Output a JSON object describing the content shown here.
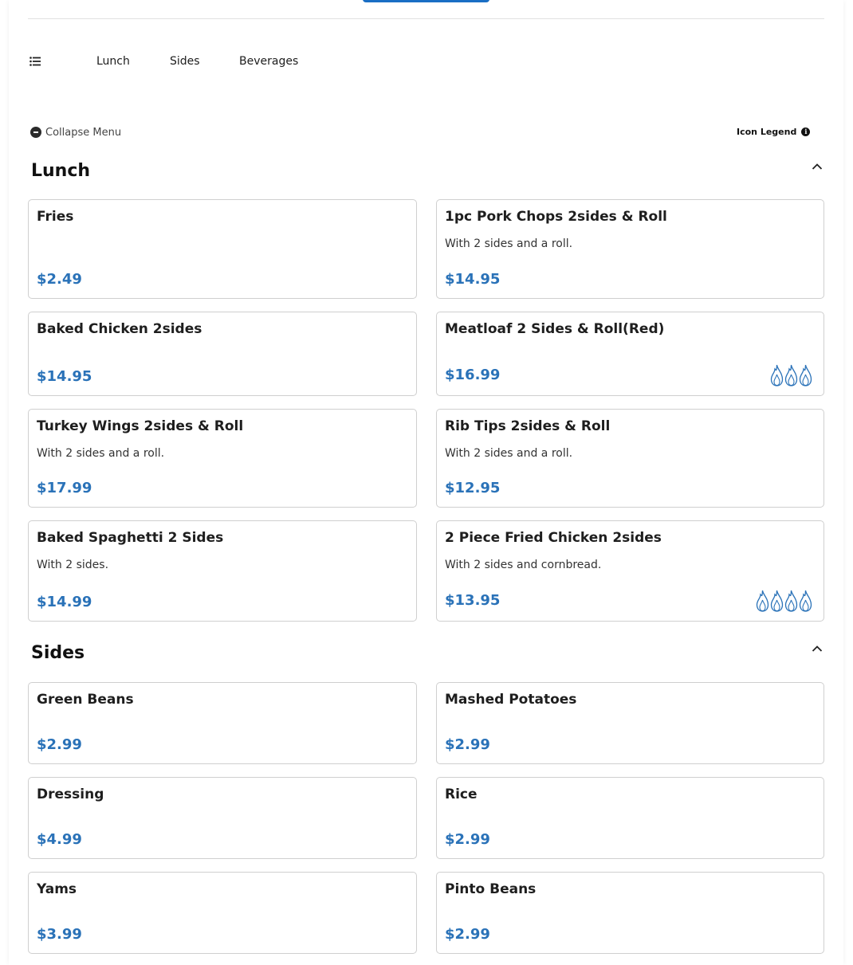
{
  "nav": {
    "items": [
      "Lunch",
      "Sides",
      "Beverages"
    ]
  },
  "controls": {
    "collapse_label": "Collapse Menu",
    "legend_label": "Icon Legend",
    "legend_icon_glyph": "i"
  },
  "sections": [
    {
      "title": "Lunch",
      "items": [
        {
          "name": "Fries",
          "description": "",
          "price": "$2.49",
          "spice_level": 0
        },
        {
          "name": "1pc Pork Chops 2sides & Roll",
          "description": "With 2 sides and a roll.",
          "price": "$14.95",
          "spice_level": 0
        },
        {
          "name": "Baked Chicken 2sides",
          "description": "",
          "price": "$14.95",
          "spice_level": 0
        },
        {
          "name": "Meatloaf 2 Sides & Roll(Red)",
          "description": "",
          "price": "$16.99",
          "spice_level": 3
        },
        {
          "name": "Turkey Wings 2sides & Roll",
          "description": "With 2 sides and a roll.",
          "price": "$17.99",
          "spice_level": 0
        },
        {
          "name": "Rib Tips 2sides & Roll",
          "description": "With 2 sides and a roll.",
          "price": "$12.95",
          "spice_level": 0
        },
        {
          "name": "Baked Spaghetti 2 Sides",
          "description": "With 2 sides.",
          "price": "$14.99",
          "spice_level": 0
        },
        {
          "name": "2 Piece Fried Chicken 2sides",
          "description": "With 2 sides and cornbread.",
          "price": "$13.95",
          "spice_level": 4
        }
      ]
    },
    {
      "title": "Sides",
      "items": [
        {
          "name": "Green Beans",
          "description": "",
          "price": "$2.99",
          "spice_level": 0
        },
        {
          "name": "Mashed Potatoes",
          "description": "",
          "price": "$2.99",
          "spice_level": 0
        },
        {
          "name": "Dressing",
          "description": "",
          "price": "$4.99",
          "spice_level": 0
        },
        {
          "name": "Rice",
          "description": "",
          "price": "$2.99",
          "spice_level": 0
        },
        {
          "name": "Yams",
          "description": "",
          "price": "$3.99",
          "spice_level": 0
        },
        {
          "name": "Pinto Beans",
          "description": "",
          "price": "$2.99",
          "spice_level": 0
        }
      ]
    }
  ],
  "colors": {
    "accent": "#2a72b8",
    "primary_button": "#1a6ec4",
    "spice_icon": "#2a72b8"
  },
  "icons": [
    "menu-list-icon",
    "collapse-minus-icon",
    "info-icon",
    "chevron-up-icon",
    "flame-icon"
  ]
}
